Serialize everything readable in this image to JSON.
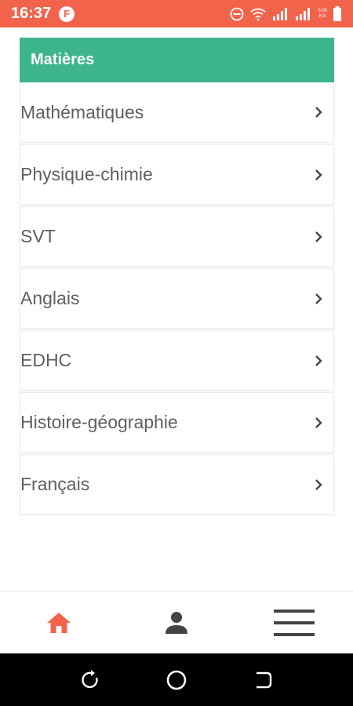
{
  "status_bar": {
    "time": "16:37",
    "app_badge": "F",
    "net_speed_value": "0.00",
    "net_speed_unit": "K/s",
    "background": "#f2634c"
  },
  "header": {
    "title": "Matières",
    "color": "#3db58a"
  },
  "subjects": [
    {
      "label": "Mathématiques"
    },
    {
      "label": "Physique-chimie"
    },
    {
      "label": "SVT"
    },
    {
      "label": "Anglais"
    },
    {
      "label": "EDHC"
    },
    {
      "label": "Histoire-géographie"
    },
    {
      "label": "Français"
    }
  ],
  "bottom_nav": {
    "active": "home",
    "active_color": "#f2634c",
    "inactive_color": "#444444",
    "items": [
      "home-icon",
      "profile-icon",
      "menu-icon"
    ]
  },
  "system_nav": {
    "items": [
      "recents-icon",
      "home-circle-icon",
      "back-icon"
    ]
  }
}
